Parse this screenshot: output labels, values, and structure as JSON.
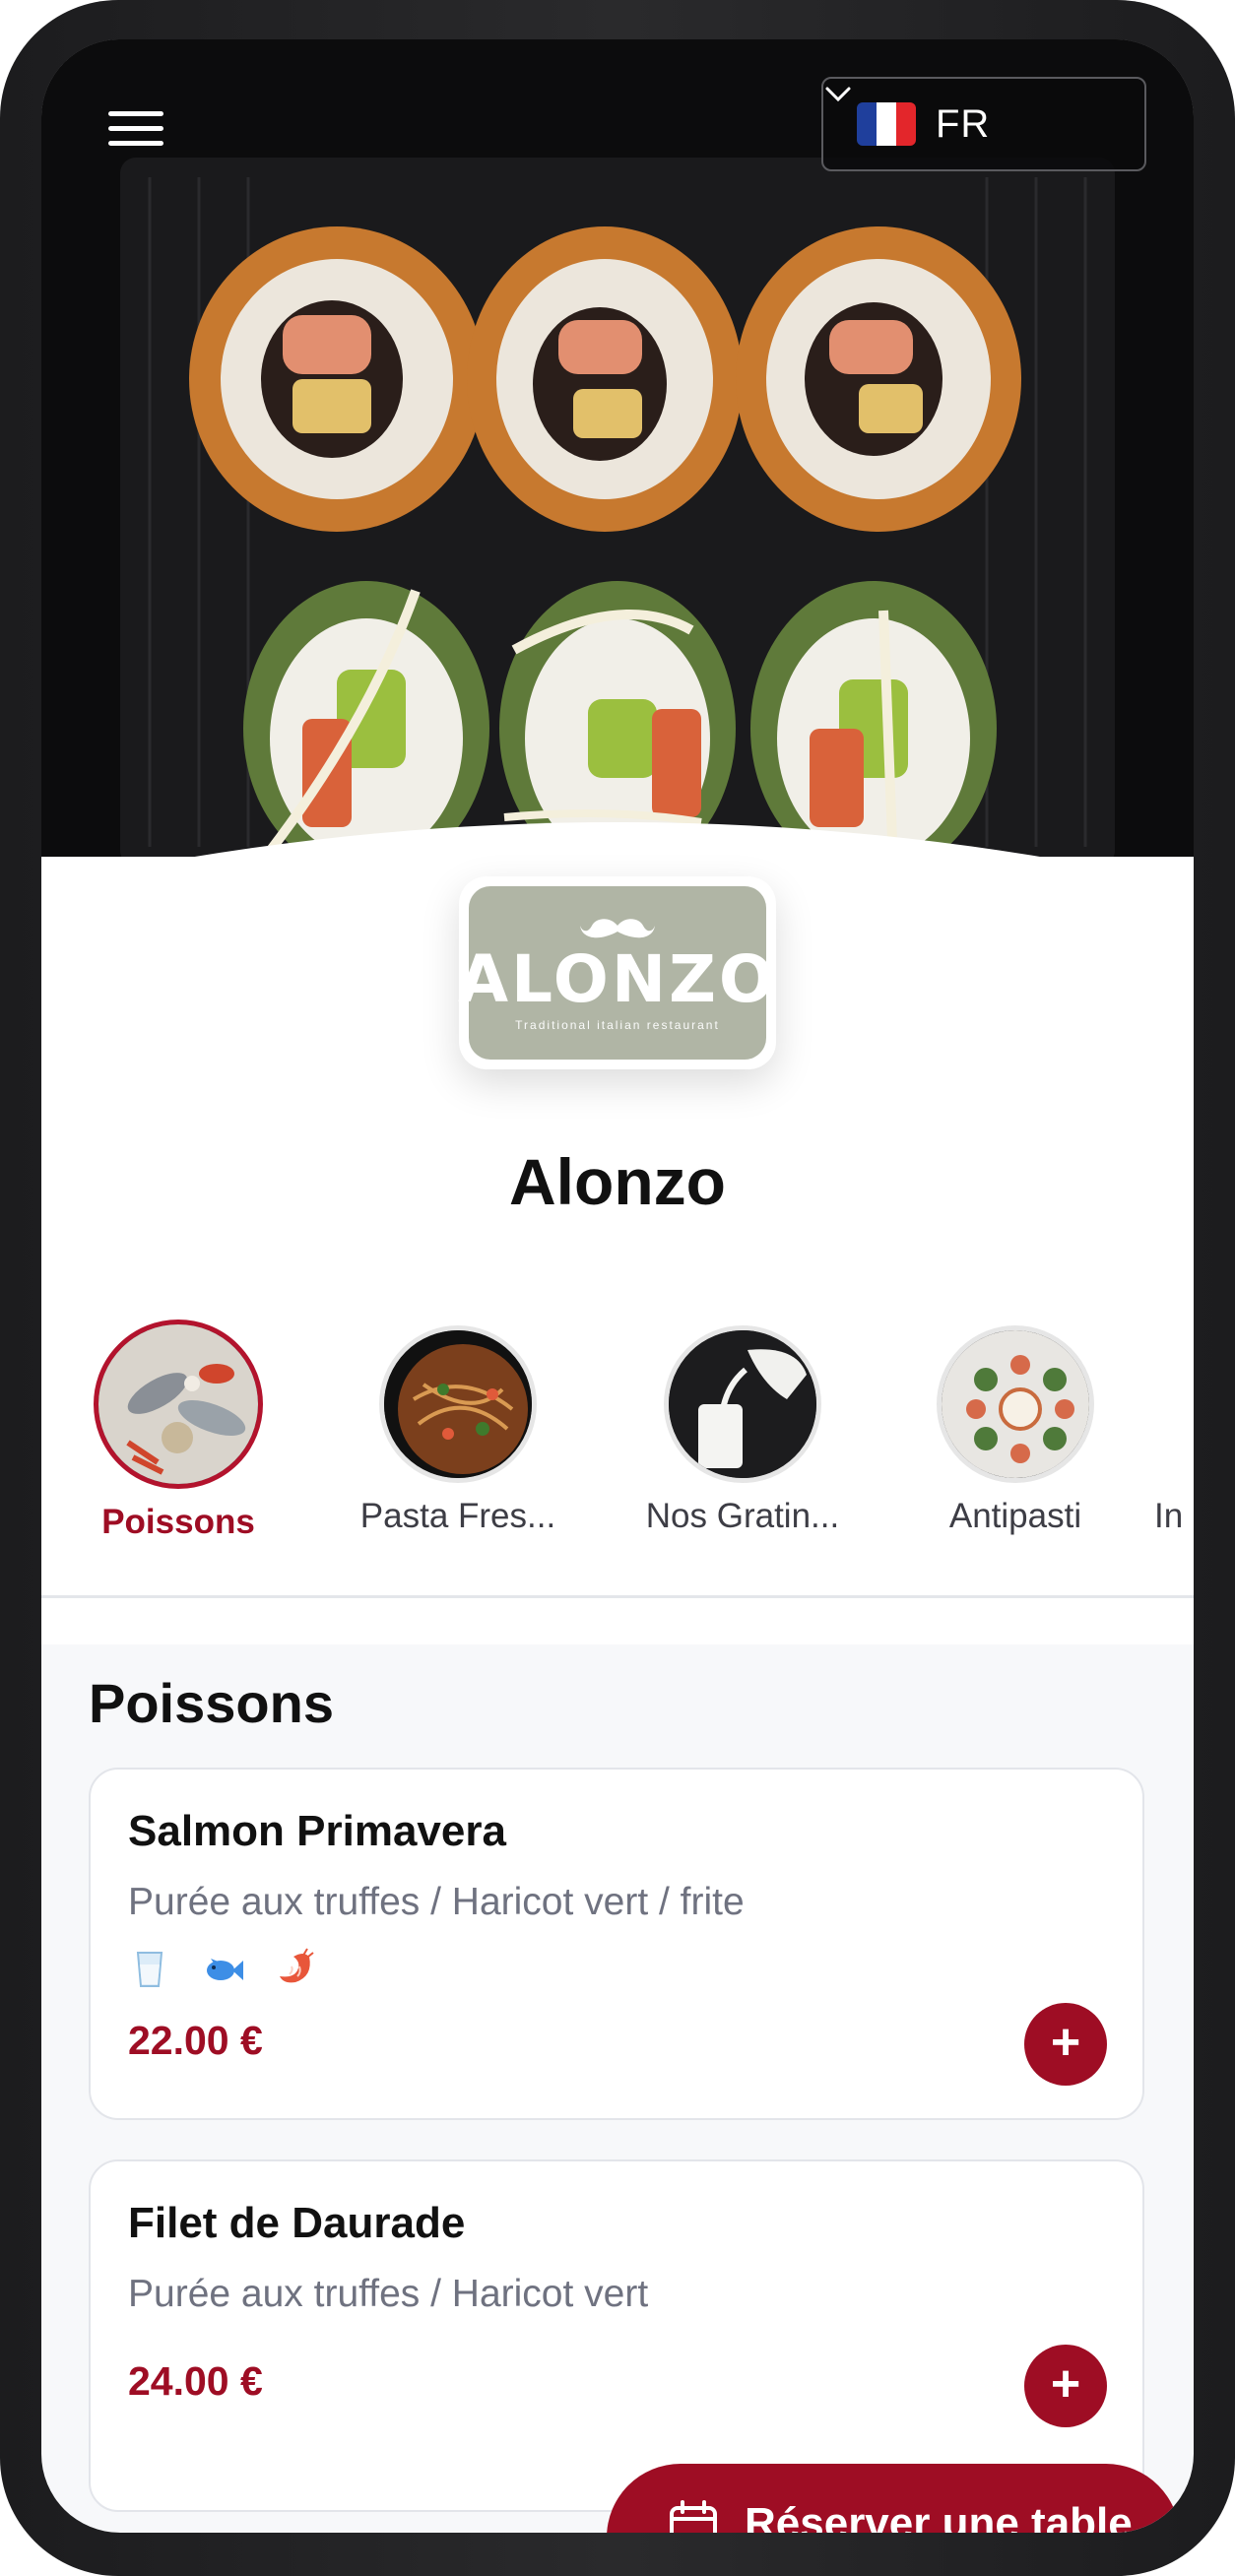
{
  "header": {
    "language": {
      "code": "FR",
      "flag_colors": [
        "#1f3f9c",
        "#ffffff",
        "#e3262b"
      ]
    }
  },
  "restaurant": {
    "logo_word": "ALONZO",
    "logo_tagline": "Traditional italian restaurant",
    "name": "Alonzo"
  },
  "categories": [
    {
      "label": "Poissons",
      "active": true
    },
    {
      "label": "Pasta Fres...",
      "active": false
    },
    {
      "label": "Nos Gratin...",
      "active": false
    },
    {
      "label": "Antipasti",
      "active": false
    },
    {
      "label": "In",
      "active": false
    }
  ],
  "menu": {
    "section_title": "Poissons",
    "items": [
      {
        "name": "Salmon Primavera",
        "description": "Purée aux truffes / Haricot vert / frite",
        "allergen_icons": [
          "milk-glass-icon",
          "fish-icon",
          "shrimp-icon"
        ],
        "price": "22.00 €"
      },
      {
        "name": "Filet de Daurade",
        "description": "Purée aux truffes / Haricot vert",
        "allergen_icons": [],
        "price": "24.00 €"
      }
    ]
  },
  "reserve_button": {
    "label": "Réserver une table"
  },
  "colors": {
    "accent": "#9e0d24",
    "logo_bg": "#b0b5a5"
  }
}
